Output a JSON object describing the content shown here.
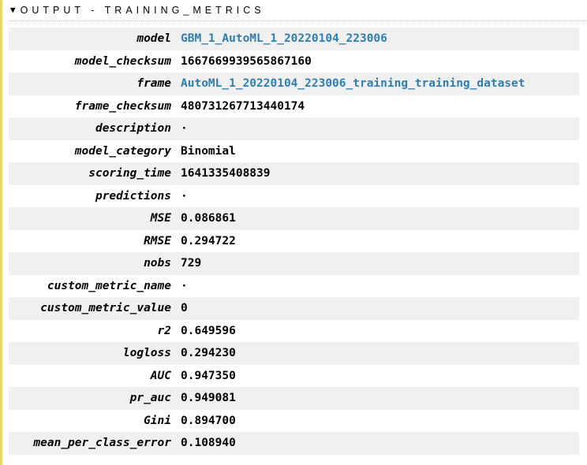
{
  "section": {
    "title": "OUTPUT - TRAINING_METRICS"
  },
  "metrics": {
    "model": {
      "label": "model",
      "value": "GBM_1_AutoML_1_20220104_223006",
      "link": true
    },
    "model_checksum": {
      "label": "model_checksum",
      "value": "1667669939565867160"
    },
    "frame": {
      "label": "frame",
      "value": "AutoML_1_20220104_223006_training_training_dataset",
      "link": true
    },
    "frame_checksum": {
      "label": "frame_checksum",
      "value": "480731267713440174"
    },
    "description": {
      "label": "description",
      "value": "",
      "empty": true
    },
    "model_category": {
      "label": "model_category",
      "value": "Binomial"
    },
    "scoring_time": {
      "label": "scoring_time",
      "value": "1641335408839"
    },
    "predictions": {
      "label": "predictions",
      "value": "",
      "empty": true
    },
    "MSE": {
      "label": "MSE",
      "value": "0.086861"
    },
    "RMSE": {
      "label": "RMSE",
      "value": "0.294722"
    },
    "nobs": {
      "label": "nobs",
      "value": "729"
    },
    "custom_metric_name": {
      "label": "custom_metric_name",
      "value": "",
      "empty": true
    },
    "custom_metric_value": {
      "label": "custom_metric_value",
      "value": "0"
    },
    "r2": {
      "label": "r2",
      "value": "0.649596"
    },
    "logloss": {
      "label": "logloss",
      "value": "0.294230"
    },
    "AUC": {
      "label": "AUC",
      "value": "0.947350"
    },
    "pr_auc": {
      "label": "pr_auc",
      "value": "0.949081"
    },
    "Gini": {
      "label": "Gini",
      "value": "0.894700"
    },
    "mean_per_class_error": {
      "label": "mean_per_class_error",
      "value": "0.108940"
    }
  }
}
